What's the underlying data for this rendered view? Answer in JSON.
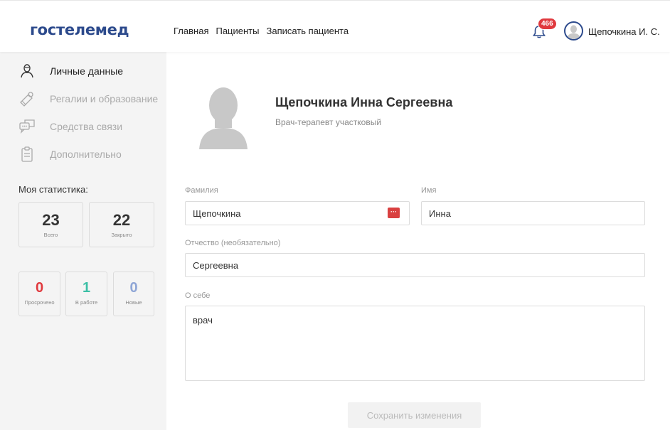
{
  "header": {
    "logo": "гостелемед",
    "nav": [
      {
        "label": "Главная"
      },
      {
        "label": "Пациенты"
      },
      {
        "label": "Записать пациента"
      }
    ],
    "notifications_count": "466",
    "user_name": "Щепочкина И. С."
  },
  "sidebar": {
    "items": [
      {
        "label": "Личные данные",
        "icon": "user-icon",
        "active": true
      },
      {
        "label": "Регалии и образование",
        "icon": "diploma-icon",
        "active": false
      },
      {
        "label": "Средства связи",
        "icon": "chat-icon",
        "active": false
      },
      {
        "label": "Дополнительно",
        "icon": "clipboard-icon",
        "active": false
      }
    ],
    "stats_title": "Моя статистика:",
    "stats_top": [
      {
        "value": "23",
        "label": "Всего"
      },
      {
        "value": "22",
        "label": "Закрыто"
      }
    ],
    "stats_bottom": [
      {
        "value": "0",
        "label": "Просрочено",
        "color": "#e0393e"
      },
      {
        "value": "1",
        "label": "В работе",
        "color": "#3cbfa6"
      },
      {
        "value": "0",
        "label": "Новые",
        "color": "#8fa6d6"
      }
    ]
  },
  "profile": {
    "full_name": "Щепочкина Инна Сергеевна",
    "position": "Врач-терапевт участковый"
  },
  "form": {
    "last_name": {
      "label": "Фамилия",
      "value": "Щепочкина"
    },
    "first_name": {
      "label": "Имя",
      "value": "Инна"
    },
    "patronymic": {
      "label": "Отчество (необязательно)",
      "value": "Сергеевна"
    },
    "about": {
      "label": "О себе",
      "value": "врач"
    },
    "save_label": "Сохранить изменения"
  },
  "colors": {
    "brand": "#2c4a8c",
    "sidebar_bg": "#f4f4f4",
    "badge": "#e0393e"
  }
}
